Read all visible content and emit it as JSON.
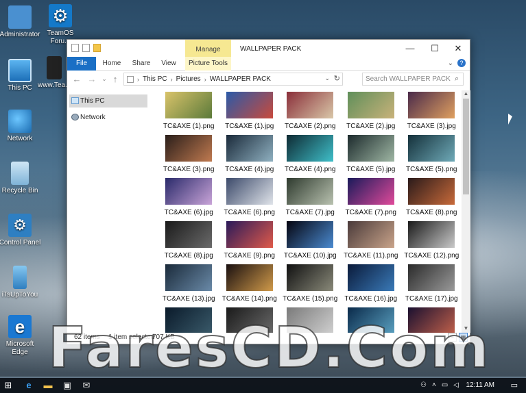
{
  "desktop": {
    "icons": [
      {
        "label": "Administrator"
      },
      {
        "label": "TeamOS Foru..."
      },
      {
        "label": "This PC"
      },
      {
        "label": "www.Tea..."
      },
      {
        "label": "Network"
      },
      {
        "label": "Recycle Bin"
      },
      {
        "label": "Control Panel"
      },
      {
        "label": "iTsUpToYou"
      },
      {
        "label": "Microsoft Edge"
      }
    ]
  },
  "window": {
    "title": "WALLPAPER PACK",
    "contextual_tab_group": "Manage",
    "ribbon_tabs": [
      "File",
      "Home",
      "Share",
      "View",
      "Picture Tools"
    ],
    "controls": {
      "minimize": "—",
      "maximize": "☐",
      "close": "✕"
    },
    "breadcrumb": [
      "This PC",
      "Pictures",
      "WALLPAPER PACK"
    ],
    "search_placeholder": "Search WALLPAPER PACK",
    "nav_pane": [
      {
        "label": "This PC",
        "selected": true
      },
      {
        "label": "Network",
        "selected": false
      }
    ],
    "files": [
      {
        "name": "TC&AXE (1).png",
        "colors": [
          "#d9c36a",
          "#5b7a3a"
        ]
      },
      {
        "name": "TC&AXE (1).jpg",
        "colors": [
          "#2b5aa8",
          "#c94a3c"
        ]
      },
      {
        "name": "TC&AXE (2).png",
        "colors": [
          "#8a2f3a",
          "#d9c7a8"
        ]
      },
      {
        "name": "TC&AXE (2).jpg",
        "colors": [
          "#5f8f5a",
          "#c9b27a"
        ]
      },
      {
        "name": "TC&AXE (3).jpg",
        "colors": [
          "#4a2a4a",
          "#e0a060"
        ]
      },
      {
        "name": "TC&AXE (3).png",
        "colors": [
          "#2a1e1a",
          "#c07a50"
        ]
      },
      {
        "name": "TC&AXE (4).jpg",
        "colors": [
          "#1a2a3a",
          "#8fb0c0"
        ]
      },
      {
        "name": "TC&AXE (4).png",
        "colors": [
          "#0e2a33",
          "#3fbfc9"
        ]
      },
      {
        "name": "TC&AXE (5).jpg",
        "colors": [
          "#1c2a2c",
          "#9fb7a4"
        ]
      },
      {
        "name": "TC&AXE (5).png",
        "colors": [
          "#14303a",
          "#6faab8"
        ]
      },
      {
        "name": "TC&AXE (6).jpg",
        "colors": [
          "#2a2a6a",
          "#c9a4d8"
        ]
      },
      {
        "name": "TC&AXE (6).png",
        "colors": [
          "#3c4a6a",
          "#e0e4ea"
        ]
      },
      {
        "name": "TC&AXE (7).jpg",
        "colors": [
          "#2e3a2e",
          "#b9c2b0"
        ]
      },
      {
        "name": "TC&AXE (7).png",
        "colors": [
          "#1a1a5a",
          "#e04a9a"
        ]
      },
      {
        "name": "TC&AXE (8).png",
        "colors": [
          "#2a1a1a",
          "#c86a3a"
        ]
      },
      {
        "name": "TC&AXE (8).jpg",
        "colors": [
          "#1a1a1a",
          "#6a6a6a"
        ]
      },
      {
        "name": "TC&AXE (9).png",
        "colors": [
          "#2a1a5a",
          "#e05a4a"
        ]
      },
      {
        "name": "TC&AXE (10).jpg",
        "colors": [
          "#050510",
          "#4a8ad0"
        ]
      },
      {
        "name": "TC&AXE (11).png",
        "colors": [
          "#4a3a3a",
          "#c9a48a"
        ]
      },
      {
        "name": "TC&AXE (12).png",
        "colors": [
          "#1a1a1a",
          "#c9c9c9"
        ]
      },
      {
        "name": "TC&AXE (13).jpg",
        "colors": [
          "#1a2a3a",
          "#6a8aa8"
        ]
      },
      {
        "name": "TC&AXE (14).png",
        "colors": [
          "#1a1010",
          "#d09a4a"
        ]
      },
      {
        "name": "TC&AXE (15).png",
        "colors": [
          "#101010",
          "#8a8a7a"
        ]
      },
      {
        "name": "TC&AXE (16).jpg",
        "colors": [
          "#0a1a3a",
          "#3a7ab8"
        ]
      },
      {
        "name": "TC&AXE (17).jpg",
        "colors": [
          "#2a2a2a",
          "#9a9a9a"
        ]
      },
      {
        "name": "",
        "colors": [
          "#0a1a2a",
          "#3a5a6a"
        ]
      },
      {
        "name": "",
        "colors": [
          "#1a1a1a",
          "#6a6a6a"
        ]
      },
      {
        "name": "",
        "colors": [
          "#7a7a7a",
          "#d0d0d0"
        ]
      },
      {
        "name": "",
        "colors": [
          "#0a2a4a",
          "#5aa0c0"
        ]
      },
      {
        "name": "",
        "colors": [
          "#1a1030",
          "#c0604a"
        ]
      }
    ],
    "status": {
      "item_count": "62 items",
      "selection": "1 item selected",
      "size": "707 KB"
    }
  },
  "watermark": "FaresCD.Com",
  "taskbar": {
    "clock": "12:11 AM"
  }
}
